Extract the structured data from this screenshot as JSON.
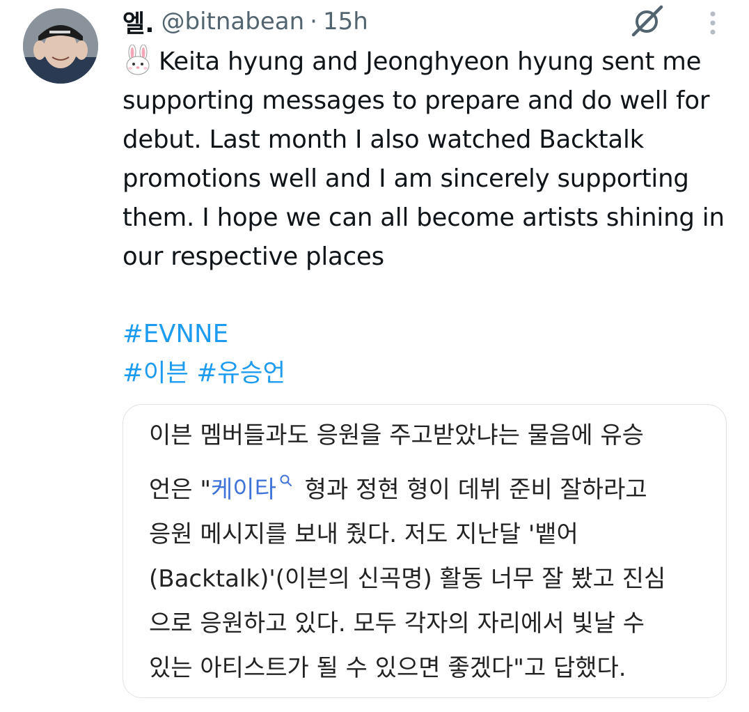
{
  "tweet": {
    "author": {
      "display_name": "엘.",
      "handle": "@bitnabean",
      "separator": "·",
      "time": "15h"
    },
    "body": {
      "emoji_icon": "rabbit-face-emoji",
      "text": "Keita hyung and Jeonghyeon hyung sent me supporting messages to prepare and do well for debut. Last month I also watched Backtalk promotions well and I am sincerely supporting them. I hope we can all become artists shining in our respective places"
    },
    "hashtags": [
      "#EVNNE",
      "#이븐",
      "#유승언"
    ],
    "media": {
      "lines": [
        "이븐 멤버들과도 응원을 주고받았냐는 물음에 유승",
        "응원 메시지를 보내 줬다. 저도 지난달 '뱉어",
        "(Backtalk)'(이븐의 신곡명) 활동 너무 잘 봤고 진심",
        "으로 응원하고 있다. 모두 각자의 자리에서 빛날 수",
        "있는 아티스트가 될 수 있으면 좋겠다\"고 답했다."
      ],
      "line2": {
        "prefix": "언은 \"",
        "link": "케이타",
        "suffix": " 형과 정현 형이 데뷔 준비 잘하라고"
      }
    }
  },
  "colors": {
    "link": "#1d9bf0",
    "secondary_text": "#536471",
    "primary_text": "#0f1419",
    "card_border": "#dfe3e6"
  }
}
